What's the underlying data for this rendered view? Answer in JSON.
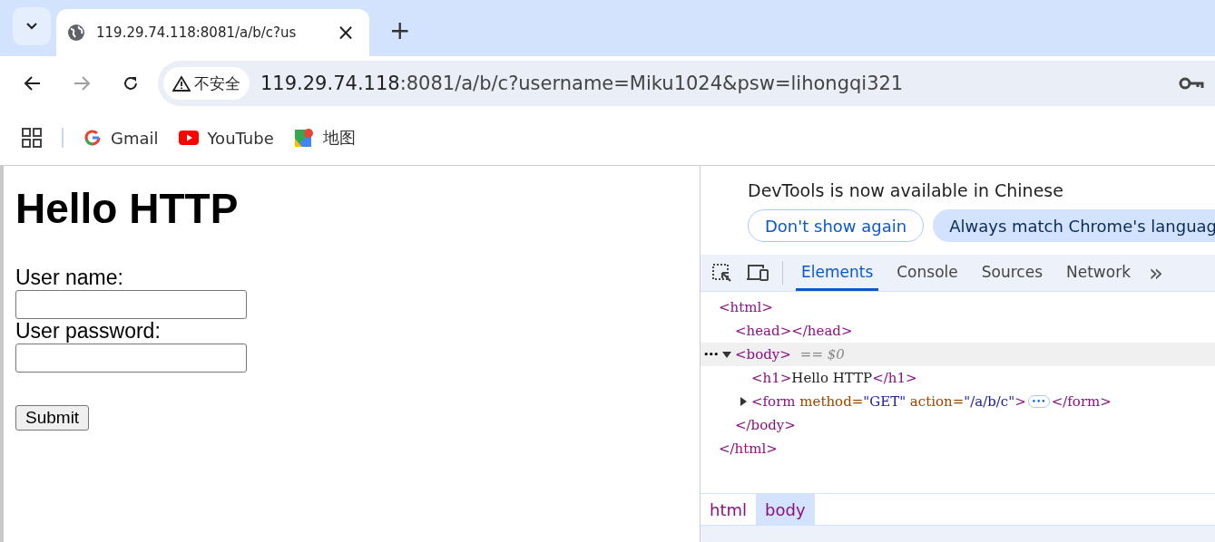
{
  "tab": {
    "title": "119.29.74.118:8081/a/b/c?us",
    "close": "×",
    "new_tab": "+"
  },
  "address_bar": {
    "security": "不安全",
    "host": "119.29.74.118",
    "rest": ":8081/a/b/c?username=Miku1024&psw=lihongqi321"
  },
  "bookmarks": [
    {
      "label": "Gmail",
      "kind": "gmail"
    },
    {
      "label": "YouTube",
      "kind": "youtube"
    },
    {
      "label": "地图",
      "kind": "maps"
    }
  ],
  "page": {
    "heading": "Hello HTTP",
    "fields": [
      {
        "label": "User name:"
      },
      {
        "label": "User password:"
      }
    ],
    "submit": "Submit"
  },
  "devtools": {
    "notice": {
      "message": "DevTools is now available in Chinese",
      "dismiss": "Don't show again",
      "accept": "Always match Chrome's languag"
    },
    "tabs": [
      {
        "label": "Elements",
        "selected": true
      },
      {
        "label": "Console",
        "selected": false
      },
      {
        "label": "Sources",
        "selected": false
      },
      {
        "label": "Network",
        "selected": false
      }
    ],
    "more": "»",
    "dom_tree": [
      {
        "tokens": [
          {
            "kind": "tag",
            "text": "<html>"
          }
        ],
        "selected": false,
        "close": "</html>",
        "children": [
          {
            "tokens": [
              {
                "kind": "tag",
                "text": "<head></head>"
              }
            ],
            "selected": false
          },
          {
            "tokens": [
              {
                "kind": "tag",
                "text": "<body>"
              }
            ],
            "note": "== $0",
            "menu": "•••",
            "expanded": true,
            "selected": true,
            "close": "</body>",
            "children": [
              {
                "tokens": [
                  {
                    "kind": "tag",
                    "text": "<h1>"
                  },
                  {
                    "kind": "text",
                    "text": "Hello HTTP"
                  },
                  {
                    "kind": "tag",
                    "text": "</h1>"
                  }
                ],
                "selected": false
              },
              {
                "tokens": [
                  {
                    "kind": "tag",
                    "text": "<form"
                  },
                  {
                    "kind": "attr",
                    "text": " method="
                  },
                  {
                    "kind": "value",
                    "text": "\"GET\""
                  },
                  {
                    "kind": "attr",
                    "text": " action="
                  },
                  {
                    "kind": "value",
                    "text": "\"/a/b/c\""
                  },
                  {
                    "kind": "tag",
                    "text": ">"
                  },
                  {
                    "kind": "ellipsis",
                    "text": "•••"
                  },
                  {
                    "kind": "tag",
                    "text": "</form>"
                  }
                ],
                "expanded": false,
                "selected": false
              }
            ]
          }
        ]
      }
    ],
    "breadcrumbs": [
      {
        "label": "html",
        "selected": false
      },
      {
        "label": "body",
        "selected": true
      }
    ]
  }
}
